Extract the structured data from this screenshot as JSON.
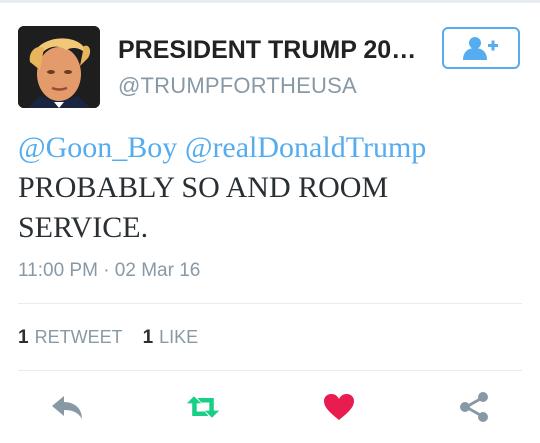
{
  "user": {
    "display_name": "PRESIDENT TRUMP 20…",
    "handle": "@TRUMPFORTHEUSA",
    "avatar_icon": "profile-photo"
  },
  "follow_button": {
    "icon": "add-user-icon",
    "color": "#55acee"
  },
  "tweet": {
    "mention_1": "@Goon_Boy",
    "mention_2": "@realDonaldTrump",
    "text": "PROBABLY SO AND ROOM SERVICE.",
    "timestamp": "11:00 PM · 02 Mar 16"
  },
  "stats": {
    "retweet_count": "1",
    "retweet_label": "RETWEET",
    "like_count": "1",
    "like_label": "LIKE"
  },
  "actions": [
    {
      "name": "reply",
      "icon": "reply-icon",
      "color": "#8899a6"
    },
    {
      "name": "retweet",
      "icon": "retweet-icon",
      "color": "#19cf86"
    },
    {
      "name": "like",
      "icon": "heart-icon",
      "color": "#e81c4f"
    },
    {
      "name": "share",
      "icon": "share-icon",
      "color": "#8899a6"
    }
  ],
  "colors": {
    "link": "#55acee",
    "text": "#292f33",
    "muted": "#8899a6"
  }
}
